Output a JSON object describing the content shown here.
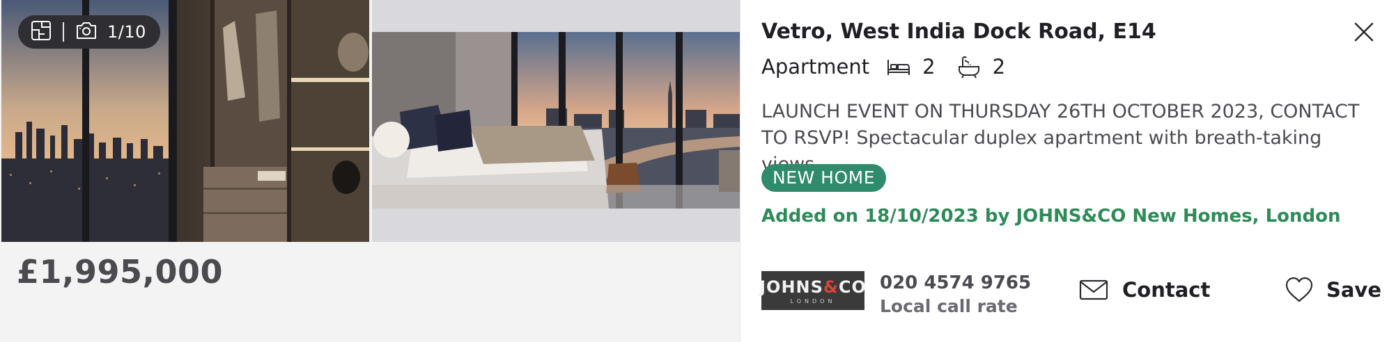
{
  "gallery": {
    "counter": "1/10",
    "icons": [
      "floorplan-icon",
      "camera-icon"
    ]
  },
  "listing": {
    "price": "£1,995,000",
    "title": "Vetro, West India Dock Road, E14",
    "type": "Apartment",
    "bedrooms": "2",
    "bathrooms": "2",
    "description": "LAUNCH EVENT ON THURSDAY 26TH OCTOBER 2023, CONTACT TO RSVP! Spectacular duplex apartment with breath-taking views",
    "tag": "NEW HOME",
    "added": "Added on 18/10/2023 by JOHNS&CO New Homes, London"
  },
  "agent": {
    "logo_main_left": "JOHNS",
    "logo_amp": "&",
    "logo_main_right": "CO",
    "logo_sub": "LONDON",
    "phone": "020 4574 9765",
    "rate": "Local call rate"
  },
  "actions": {
    "contact_label": "Contact",
    "save_label": "Save"
  },
  "colors": {
    "tag_bg": "#2e8b6b",
    "added_text": "#2e8b57",
    "badge_bg": "#2e2e33"
  }
}
